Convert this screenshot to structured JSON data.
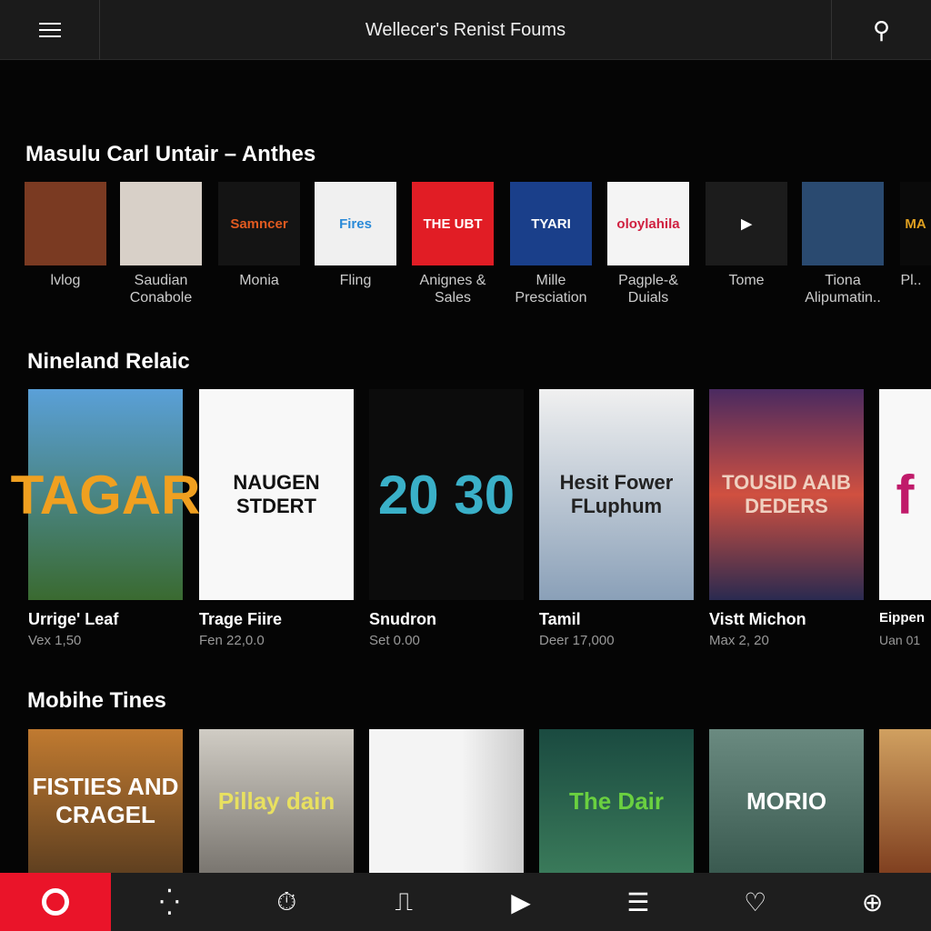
{
  "header": {
    "title": "Wellecer's Renist Foums",
    "menu_icon": "hamburger-icon",
    "action_icon": "cast-icon"
  },
  "section1": {
    "title": "Masulu Carl Untair – Anthes",
    "items": [
      {
        "label": "lvlog",
        "art": "",
        "bg": "#7a3a22"
      },
      {
        "label": "Saudian Conabole",
        "art": "",
        "bg": "#d8d0c8"
      },
      {
        "label": "Monia",
        "art": "Samncer",
        "bg": "#141414",
        "fg": "#e05a20"
      },
      {
        "label": "Fling",
        "art": "Fires",
        "bg": "#f0f0f0",
        "fg": "#2a8ad8"
      },
      {
        "label": "Anignes & Sales",
        "art": "THE UBT",
        "bg": "#e11d25",
        "fg": "#fff"
      },
      {
        "label": "Mille Presciation",
        "art": "TYARI",
        "bg": "#1a3f8a",
        "fg": "#fff"
      },
      {
        "label": "Pagple-& Duials",
        "art": "oloylahila",
        "bg": "#f4f4f4",
        "fg": "#d02040"
      },
      {
        "label": "Tome",
        "art": "▶",
        "bg": "#1c1c1c",
        "fg": "#fff"
      },
      {
        "label": "Tiona Alipumatin..",
        "art": "",
        "bg": "#2a4a70"
      },
      {
        "label": "Pl..",
        "art": "MA",
        "bg": "#0a0a0a",
        "fg": "#e0a020"
      }
    ]
  },
  "section2": {
    "title": "Nineland Relaic",
    "items": [
      {
        "title": "Urrige' Leaf",
        "sub": "Vex 1,50",
        "art": "TAGAR",
        "bg": "linear-gradient(#5aa0d8,#3a6a30)",
        "fg": "#f0a020"
      },
      {
        "title": "Trage Fiire",
        "sub": "Fen 22,0.0",
        "art": "NAUGEN STDERT",
        "bg": "#f8f8f8",
        "fg": "#111"
      },
      {
        "title": "Snudron",
        "sub": "Set 0.00",
        "art": "20 30",
        "bg": "#0c0c0c",
        "fg": "#3ab0c8"
      },
      {
        "title": "Tamil",
        "sub": "Deer 17,000",
        "art": "Hesit Fower FLuphum",
        "bg": "linear-gradient(#f0f0f0,#8aa0b8)",
        "fg": "#222"
      },
      {
        "title": "Vistt Michon",
        "sub": "Max 2, 20",
        "art": "TOUSID AAIB DEDERS",
        "bg": "linear-gradient(#4a2a60,#d05040,#2a2a50)",
        "fg": "#f0d0c0"
      },
      {
        "title": "Eippen",
        "sub": "Uan 01",
        "art": "f",
        "bg": "#f8f8f8",
        "fg": "#c01a6a"
      }
    ]
  },
  "section3": {
    "title": "Mobihe Tines",
    "items": [
      {
        "art": "FISTIES AND CRAGEL",
        "bg": "linear-gradient(#c07a30,#604020)",
        "fg": "#fff"
      },
      {
        "art": "Pillay dain",
        "bg": "linear-gradient(#d0ccc4,#7a7670)",
        "fg": "#e8e060"
      },
      {
        "art": "",
        "bg": "linear-gradient(90deg,#f4f4f4,#f4f4f4 60%,#ccc)",
        "fg": "#111"
      },
      {
        "art": "The Dair",
        "bg": "linear-gradient(#1a4a40,#3a7a5a)",
        "fg": "#6ad040"
      },
      {
        "art": "MORIO",
        "bg": "linear-gradient(#6a8a80,#3a5a50)",
        "fg": "#fff"
      },
      {
        "art": "",
        "bg": "linear-gradient(#d0a060,#804020)",
        "fg": "#fff"
      }
    ]
  },
  "nav": [
    {
      "name": "home",
      "glyph": ""
    },
    {
      "name": "sparkle",
      "glyph": "⁛"
    },
    {
      "name": "timer",
      "glyph": "⏱"
    },
    {
      "name": "library",
      "glyph": "⎍"
    },
    {
      "name": "play",
      "glyph": "▶"
    },
    {
      "name": "list",
      "glyph": "☰"
    },
    {
      "name": "favorites",
      "glyph": "♡"
    },
    {
      "name": "download",
      "glyph": "⊕"
    }
  ]
}
